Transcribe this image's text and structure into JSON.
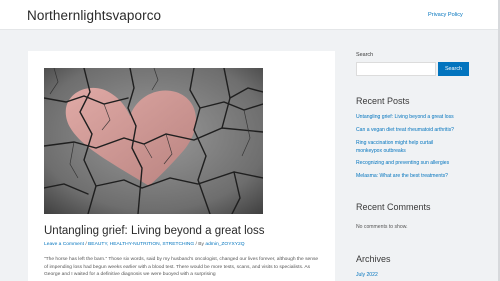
{
  "header": {
    "site_title": "Northernlightsvaporco",
    "nav_privacy": "Privacy Policy"
  },
  "post": {
    "title": "Untangling grief: Living beyond a great loss",
    "meta": {
      "comment_link": "Leave a Comment",
      "sep1": " / ",
      "categories": "BEAUTY, HEALTHY-NUTRITION, STRETCHING",
      "sep2": " / By ",
      "author": "admin_ZOYXY2Q"
    },
    "excerpt": "“The horse has left the barn.” Those six words, said by my husband’s oncologist, changed our lives forever, although the sense of impending loss had begun weeks earlier with a blood test. There would be more tests, scans, and visits to specialists. As George and I waited for a definitive diagnosis we were buoyed with a surprising",
    "image_icon": "cracked-heart-image"
  },
  "sidebar": {
    "search": {
      "label": "Search",
      "placeholder": "",
      "button": "Search"
    },
    "recent_posts": {
      "heading": "Recent Posts",
      "items": [
        "Untangling grief: Living beyond a great loss",
        "Can a vegan diet treat rheumatoid arthritis?",
        "Ring vaccination might help curtail",
        "monkeypox outbreaks",
        "Recognizing and preventing sun allergies",
        "Melasma: What are the best treatments?"
      ]
    },
    "recent_comments": {
      "heading": "Recent Comments",
      "empty_text": "No comments to show."
    },
    "archives": {
      "heading": "Archives",
      "items": [
        "July 2022"
      ]
    }
  },
  "colors": {
    "accent": "#0274be",
    "background": "#f0f2f4",
    "text": "#3a3a3a"
  }
}
